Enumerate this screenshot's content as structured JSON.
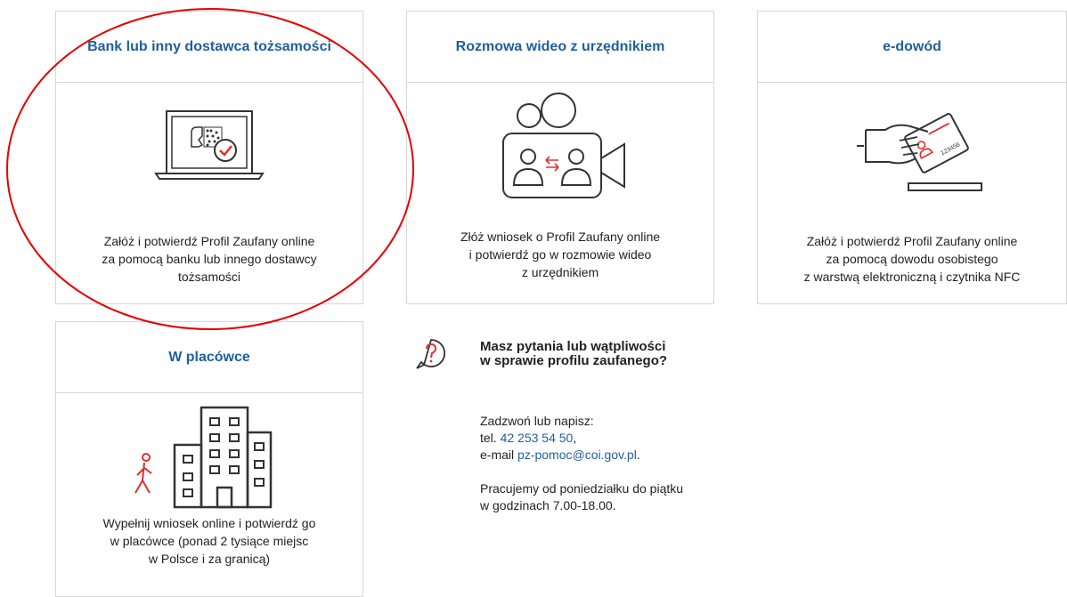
{
  "cards": [
    {
      "title": "Bank lub inny dostawca tożsamości",
      "icon": "laptop-id-check-icon",
      "desc_lines": [
        "Załóż i potwierdź Profil Zaufany online",
        "za pomocą banku lub innego dostawcy",
        "tożsamości"
      ]
    },
    {
      "title": "Rozmowa wideo z urzędnikiem",
      "icon": "video-call-icon",
      "desc_lines": [
        "Złóż wniosek o Profil Zaufany online",
        "i potwierdź go w rozmowie wideo",
        "z urzędnikiem"
      ]
    },
    {
      "title": "e-dowód",
      "icon": "hand-id-card-icon",
      "card_number": "123456",
      "desc_lines": [
        "Załóż i potwierdź Profil Zaufany online",
        "za pomocą dowodu osobistego",
        "z warstwą elektroniczną i czytnika NFC"
      ]
    },
    {
      "title": "W placówce",
      "icon": "building-walker-icon",
      "desc_lines": [
        "Wypełnij wniosek online i potwierdź go",
        "w placówce (ponad 2 tysiące miejsc",
        "w Polsce i za granicą)"
      ]
    }
  ],
  "help": {
    "icon": "question-bubble-icon",
    "title_lines": [
      "Masz pytania lub wątpliwości",
      "w sprawie profilu zaufanego?"
    ],
    "contact_intro": "Zadzwoń lub napisz:",
    "phone_prefix": "tel. ",
    "phone": "42 253 54 50",
    "phone_suffix": ",",
    "email_prefix": "e-mail ",
    "email": "pz-pomoc@coi.gov.pl",
    "email_suffix": ".",
    "hours_line1": "Pracujemy od poniedziałku do piątku",
    "hours_line2": "w godzinach 7.00-18.00."
  },
  "colors": {
    "link_blue": "#1f5f9f",
    "accent_red": "#e0302e",
    "annotation_red": "#e60000",
    "border": "#d7d7d7"
  }
}
